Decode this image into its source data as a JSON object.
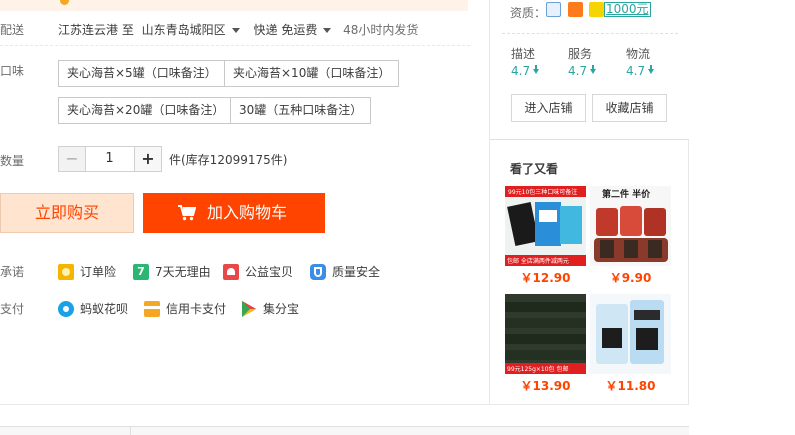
{
  "shipping": {
    "label": "配送",
    "from": "江苏连云港 至",
    "to": "山东青岛城阳区",
    "method": "快递 免运费",
    "dispatch": "48小时内发货"
  },
  "flavor": {
    "label": "口味",
    "options": [
      "夹心海苔×5罐（口味备注）",
      "夹心海苔×10罐（口味备注）",
      "夹心海苔×20罐（口味备注）",
      "30罐（五种口味备注）"
    ]
  },
  "quantity": {
    "label": "数量",
    "minus": "−",
    "value": "1",
    "plus": "+",
    "stock": "件(库存12099175件)"
  },
  "actions": {
    "buy_now": "立即购买",
    "add_cart": "加入购物车"
  },
  "promise": {
    "label": "承诺",
    "items": [
      "订单险",
      "7天无理由",
      "公益宝贝",
      "质量安全"
    ]
  },
  "payment": {
    "label": "支付",
    "items": [
      "蚂蚁花呗",
      "信用卡支付",
      "集分宝"
    ]
  },
  "shop": {
    "qualification_label": "资质：",
    "qualification_value": "1000元",
    "scores": [
      {
        "name": "描述",
        "value": "4.7"
      },
      {
        "name": "服务",
        "value": "4.7"
      },
      {
        "name": "物流",
        "value": "4.7"
      }
    ],
    "enter_shop": "进入店铺",
    "favorite_shop": "收藏店铺"
  },
  "also_viewed": {
    "title": "看了又看",
    "items": [
      {
        "price": "￥12.90",
        "banner": "99元10包三种口味可备注",
        "foot": "包邮 全店满两件减两元"
      },
      {
        "price": "￥9.90",
        "banner": "第二件 半价"
      },
      {
        "price": "￥13.90",
        "foot": "99元125g×10包 包邮"
      },
      {
        "price": "￥11.80"
      }
    ]
  },
  "colors": {
    "accent": "#ff4400",
    "teal": "#2aa6a0"
  }
}
